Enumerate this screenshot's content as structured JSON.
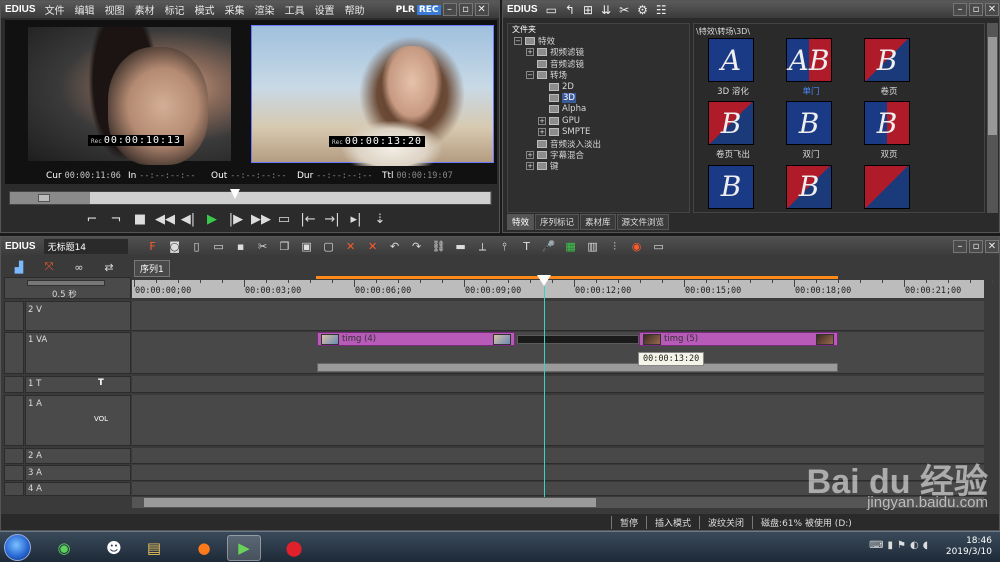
{
  "player": {
    "app_name": "EDIUS",
    "menu": [
      "文件",
      "编辑",
      "视图",
      "素材",
      "标记",
      "模式",
      "采集",
      "渲染",
      "工具",
      "设置",
      "帮助"
    ],
    "plr": "PLR",
    "rec": "REC",
    "left_timecode": "00:00:10:13",
    "right_timecode": "00:00:13:20",
    "rec_tag": "Rec",
    "cur_label": "Cur",
    "cur_value": "00:00:11:06",
    "in_label": "In",
    "in_value": "--:--:--:--",
    "out_label": "Out",
    "out_value": "--:--:--:--",
    "dur_label": "Dur",
    "dur_value": "--:--:--:--",
    "ttl_label": "Ttl",
    "ttl_value": "00:00:19:07",
    "scrub_position": 0.55
  },
  "bin": {
    "app_name": "EDIUS",
    "folder_header": "文件夹",
    "path": "\\特效\\转场\\3D\\",
    "tree": [
      {
        "label": "特效",
        "indent": 0,
        "exp": "−"
      },
      {
        "label": "视频滤镜",
        "indent": 1,
        "exp": "+"
      },
      {
        "label": "音频滤镜",
        "indent": 1,
        "exp": ""
      },
      {
        "label": "转场",
        "indent": 1,
        "exp": "−"
      },
      {
        "label": "2D",
        "indent": 2,
        "exp": ""
      },
      {
        "label": "3D",
        "indent": 2,
        "exp": "",
        "selected": true
      },
      {
        "label": "Alpha",
        "indent": 2,
        "exp": ""
      },
      {
        "label": "GPU",
        "indent": 2,
        "exp": "+"
      },
      {
        "label": "SMPTE",
        "indent": 2,
        "exp": "+"
      },
      {
        "label": "音频淡入淡出",
        "indent": 1,
        "exp": ""
      },
      {
        "label": "字幕混合",
        "indent": 1,
        "exp": "+"
      },
      {
        "label": "键",
        "indent": 1,
        "exp": "+"
      }
    ],
    "effects": [
      {
        "label": "3D 溶化",
        "glyph": "A",
        "style": "blue"
      },
      {
        "label": "单门",
        "glyph": "AB",
        "style": "half",
        "selected": true
      },
      {
        "label": "卷页",
        "glyph": "B",
        "style": "red"
      },
      {
        "label": "卷页飞出",
        "glyph": "B",
        "style": "red"
      },
      {
        "label": "双门",
        "glyph": "B",
        "style": "blue"
      },
      {
        "label": "双页",
        "glyph": "B",
        "style": "half"
      },
      {
        "label": "",
        "glyph": "B",
        "style": "blue"
      },
      {
        "label": "",
        "glyph": "B",
        "style": "red"
      },
      {
        "label": "",
        "glyph": "",
        "style": "red"
      }
    ],
    "tabs": [
      "特效",
      "序列标记",
      "素材库",
      "源文件浏览"
    ]
  },
  "timeline": {
    "app_name": "EDIUS",
    "project_name": "无标题14",
    "sequence_tab": "序列1",
    "zoom": "0.5 秒",
    "ruler": [
      "00:00:00;00",
      "00:00:03;00",
      "00:00:06;00",
      "00:00:09;00",
      "00:00:12;00",
      "00:00:15;00",
      "00:00:18;00",
      "00:00:21;00"
    ],
    "tracks": [
      {
        "name": "2 V"
      },
      {
        "name": "1 VA"
      },
      {
        "name": "1 T"
      },
      {
        "name": "1 A",
        "vol": "VOL"
      },
      {
        "name": "2 A"
      },
      {
        "name": "3 A"
      },
      {
        "name": "4 A"
      }
    ],
    "clip1": "timg (4)",
    "clip2": "timg (5)",
    "tooltip": "00:00:13:20",
    "status": [
      "暂停",
      "插入模式",
      "波纹关闭",
      "磁盘:61% 被使用 (D:)"
    ]
  },
  "taskbar": {
    "time": "18:46",
    "date": "2019/3/10"
  },
  "watermark": {
    "logo": "Bai du 经验",
    "url": "jingyan.baidu.com"
  }
}
